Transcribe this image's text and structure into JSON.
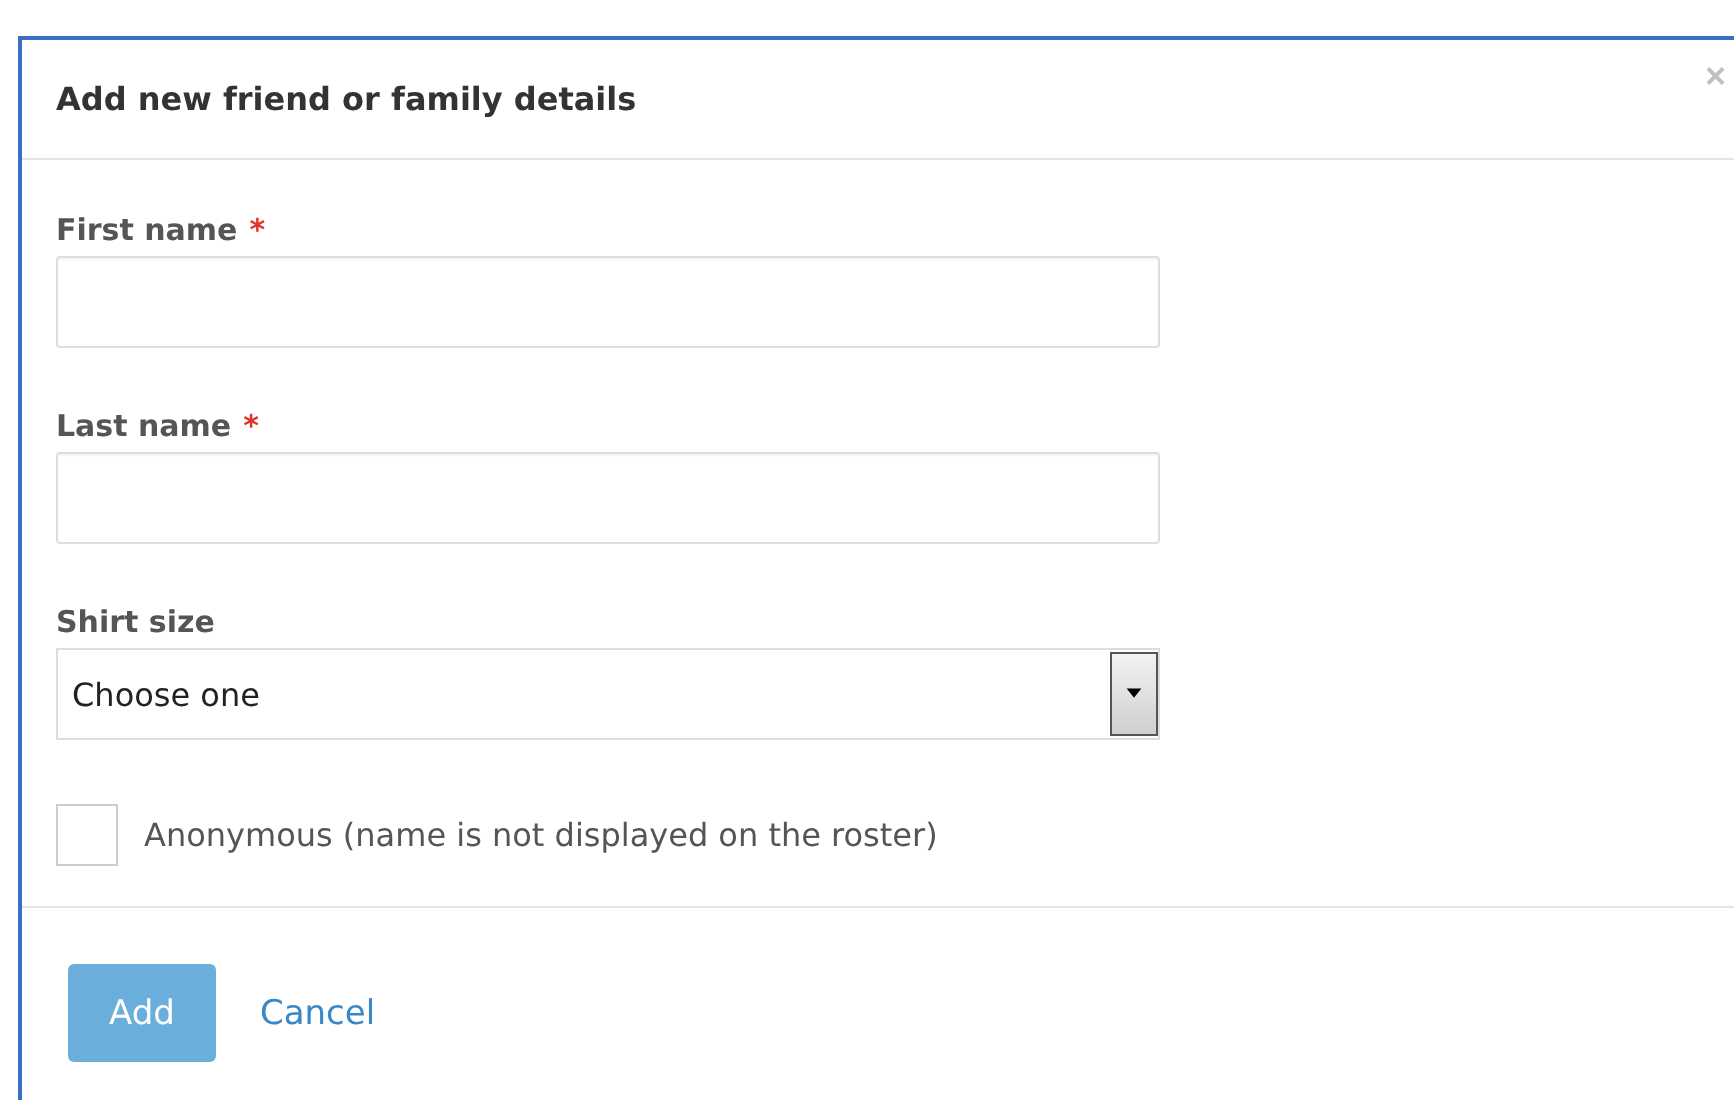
{
  "dialog": {
    "title": "Add new friend or family details",
    "close": "×"
  },
  "fields": [
    {
      "kind": "text",
      "label": "First name",
      "required_mark": "*"
    },
    {
      "kind": "text",
      "label": "Last name",
      "required_mark": "*"
    },
    {
      "kind": "select",
      "label": "Shirt size",
      "value": "Choose one"
    }
  ],
  "checkbox": {
    "label": "Anonymous (name is not displayed on the roster)",
    "checked": false
  },
  "buttons": [
    {
      "kind": "primary",
      "label": "Add"
    },
    {
      "kind": "link",
      "label": "Cancel"
    }
  ]
}
